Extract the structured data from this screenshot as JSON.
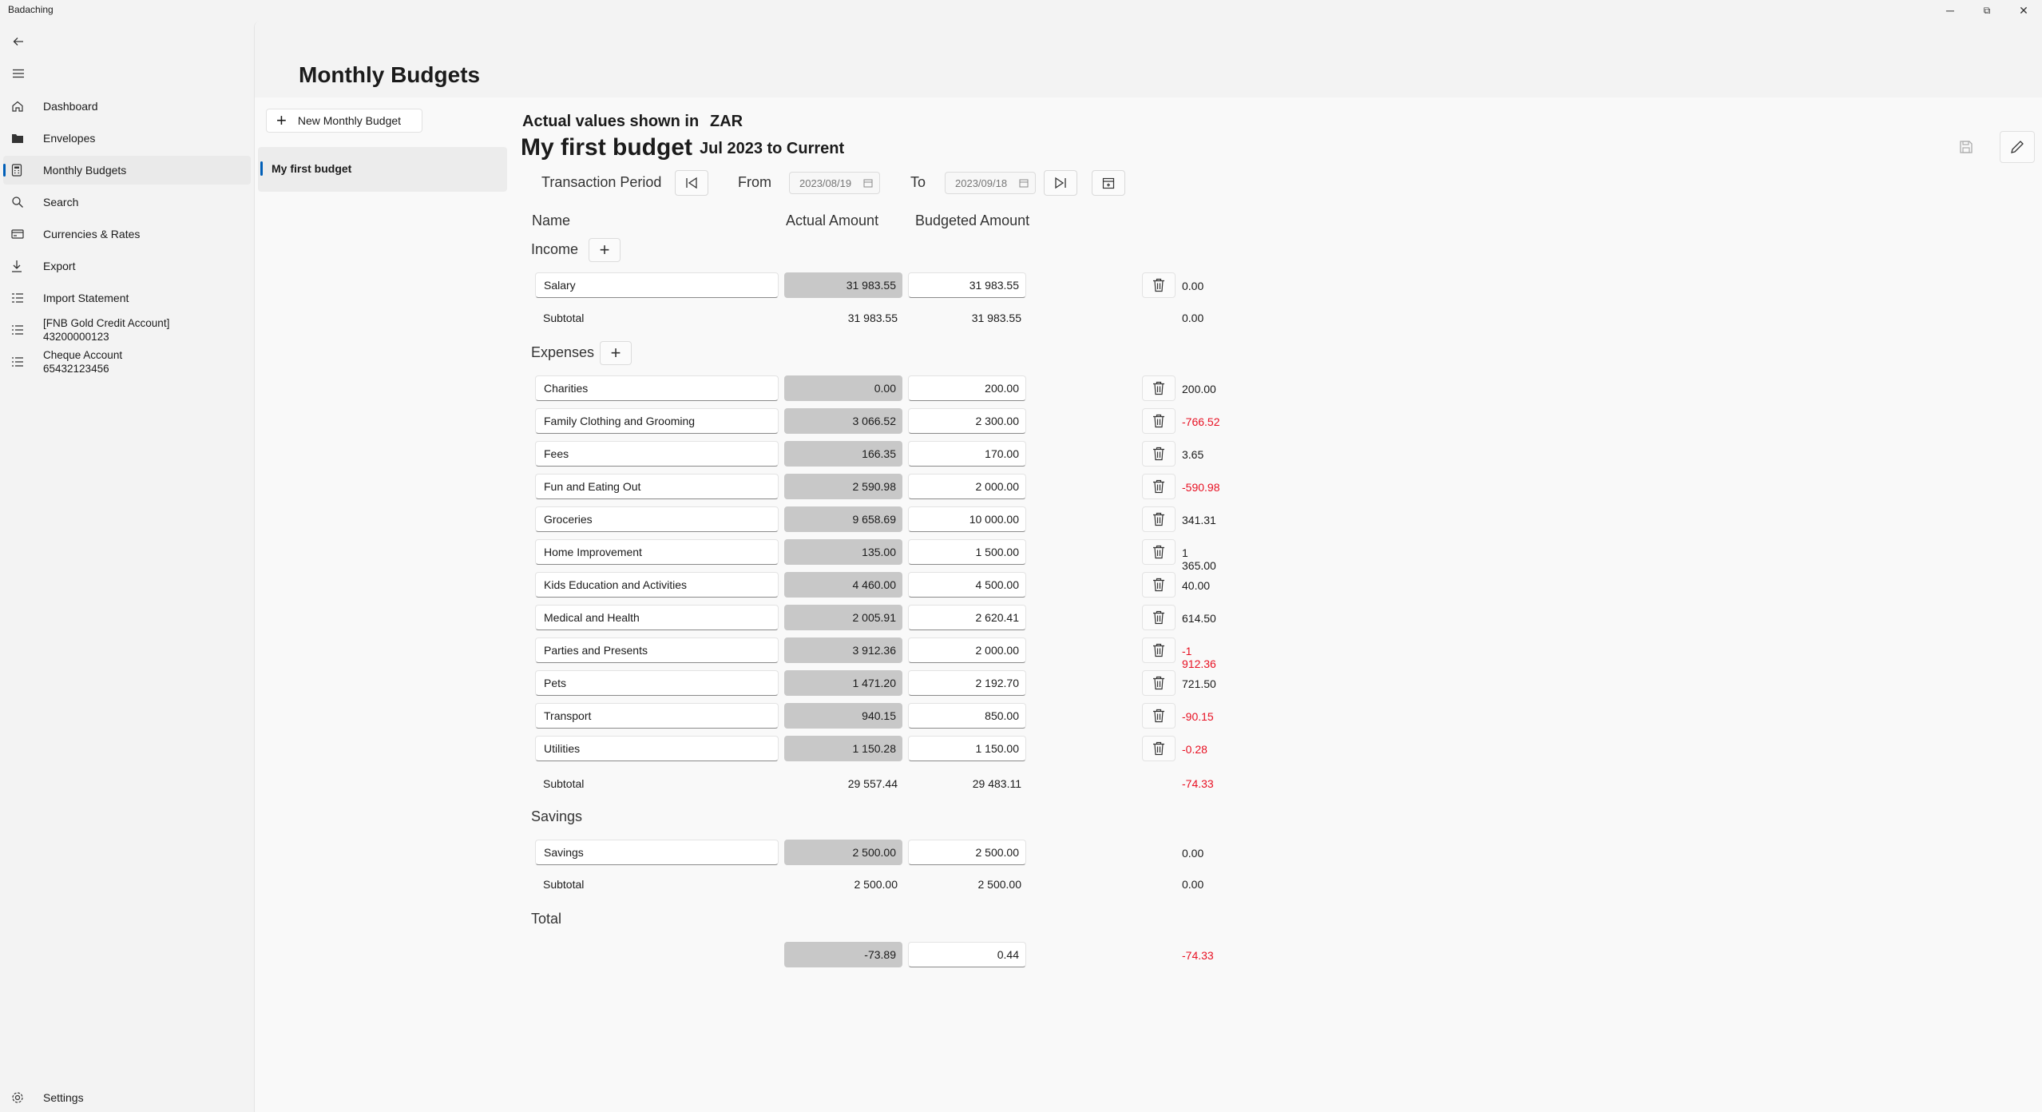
{
  "window": {
    "title": "Badaching",
    "minimize": "─",
    "maximize": "⧉",
    "close": "✕"
  },
  "nav": {
    "items": [
      {
        "label": "Dashboard",
        "icon": "home-icon"
      },
      {
        "label": "Envelopes",
        "icon": "folder-icon"
      },
      {
        "label": "Monthly Budgets",
        "icon": "calculator-icon",
        "selected": true
      },
      {
        "label": "Search",
        "icon": "search-icon"
      },
      {
        "label": "Currencies & Rates",
        "icon": "currency-icon"
      },
      {
        "label": "Export",
        "icon": "download-icon"
      },
      {
        "label": "Import Statement",
        "icon": "import-list-icon"
      }
    ],
    "accounts": [
      {
        "line1": "[FNB Gold Credit Account]",
        "line2": "43200000123"
      },
      {
        "line1": "Cheque Account",
        "line2": "65432123456"
      }
    ],
    "settings": "Settings"
  },
  "page": {
    "title": "Monthly Budgets"
  },
  "budgets": {
    "new_label": "New Monthly Budget",
    "list": [
      {
        "name": "My first budget",
        "selected": true
      }
    ]
  },
  "detail": {
    "actual_values_label": "Actual values shown in",
    "currency": "ZAR",
    "budget_name": "My first budget",
    "period_text": "Jul 2023 to Current",
    "transaction_period_label": "Transaction Period",
    "from_label": "From",
    "from_date": "2023/08/19",
    "to_label": "To",
    "to_date": "2023/09/18",
    "columns": {
      "name": "Name",
      "actual": "Actual Amount",
      "budgeted": "Budgeted Amount"
    },
    "subtotal_label": "Subtotal",
    "income": {
      "label": "Income",
      "rows": [
        {
          "name": "Salary",
          "actual": "31 983.55",
          "budgeted": "31 983.55",
          "diff": "0.00",
          "neg": false
        }
      ],
      "subtotal": {
        "actual": "31 983.55",
        "budgeted": "31 983.55",
        "diff": "0.00",
        "neg": false
      }
    },
    "expenses": {
      "label": "Expenses",
      "rows": [
        {
          "name": "Charities",
          "actual": "0.00",
          "budgeted": "200.00",
          "diff": "200.00",
          "neg": false
        },
        {
          "name": "Family Clothing and Grooming",
          "actual": "3 066.52",
          "budgeted": "2 300.00",
          "diff": "-766.52",
          "neg": true
        },
        {
          "name": "Fees",
          "actual": "166.35",
          "budgeted": "170.00",
          "diff": "3.65",
          "neg": false
        },
        {
          "name": "Fun and Eating Out",
          "actual": "2 590.98",
          "budgeted": "2 000.00",
          "diff": "-590.98",
          "neg": true
        },
        {
          "name": "Groceries",
          "actual": "9 658.69",
          "budgeted": "10 000.00",
          "diff": "341.31",
          "neg": false
        },
        {
          "name": "Home Improvement",
          "actual": "135.00",
          "budgeted": "1 500.00",
          "diff": "1 365.00",
          "neg": false
        },
        {
          "name": "Kids Education and Activities",
          "actual": "4 460.00",
          "budgeted": "4 500.00",
          "diff": "40.00",
          "neg": false
        },
        {
          "name": "Medical and Health",
          "actual": "2 005.91",
          "budgeted": "2 620.41",
          "diff": "614.50",
          "neg": false
        },
        {
          "name": "Parties and Presents",
          "actual": "3 912.36",
          "budgeted": "2 000.00",
          "diff": "-1 912.36",
          "neg": true
        },
        {
          "name": "Pets",
          "actual": "1 471.20",
          "budgeted": "2 192.70",
          "diff": "721.50",
          "neg": false
        },
        {
          "name": "Transport",
          "actual": "940.15",
          "budgeted": "850.00",
          "diff": "-90.15",
          "neg": true
        },
        {
          "name": "Utilities",
          "actual": "1 150.28",
          "budgeted": "1 150.00",
          "diff": "-0.28",
          "neg": true
        }
      ],
      "subtotal": {
        "actual": "29 557.44",
        "budgeted": "29 483.11",
        "diff": "-74.33",
        "neg": true
      }
    },
    "savings": {
      "label": "Savings",
      "rows": [
        {
          "name": "Savings",
          "actual": "2 500.00",
          "budgeted": "2 500.00",
          "diff": "0.00",
          "neg": false
        }
      ],
      "subtotal": {
        "actual": "2 500.00",
        "budgeted": "2 500.00",
        "diff": "0.00",
        "neg": false
      }
    },
    "total": {
      "label": "Total",
      "actual": "-73.89",
      "budgeted": "0.44",
      "diff": "-74.33",
      "neg": true
    }
  },
  "colors": {
    "accent": "#005fb8",
    "negative": "#e81123",
    "actual_field_bg": "#c8c8c8"
  }
}
